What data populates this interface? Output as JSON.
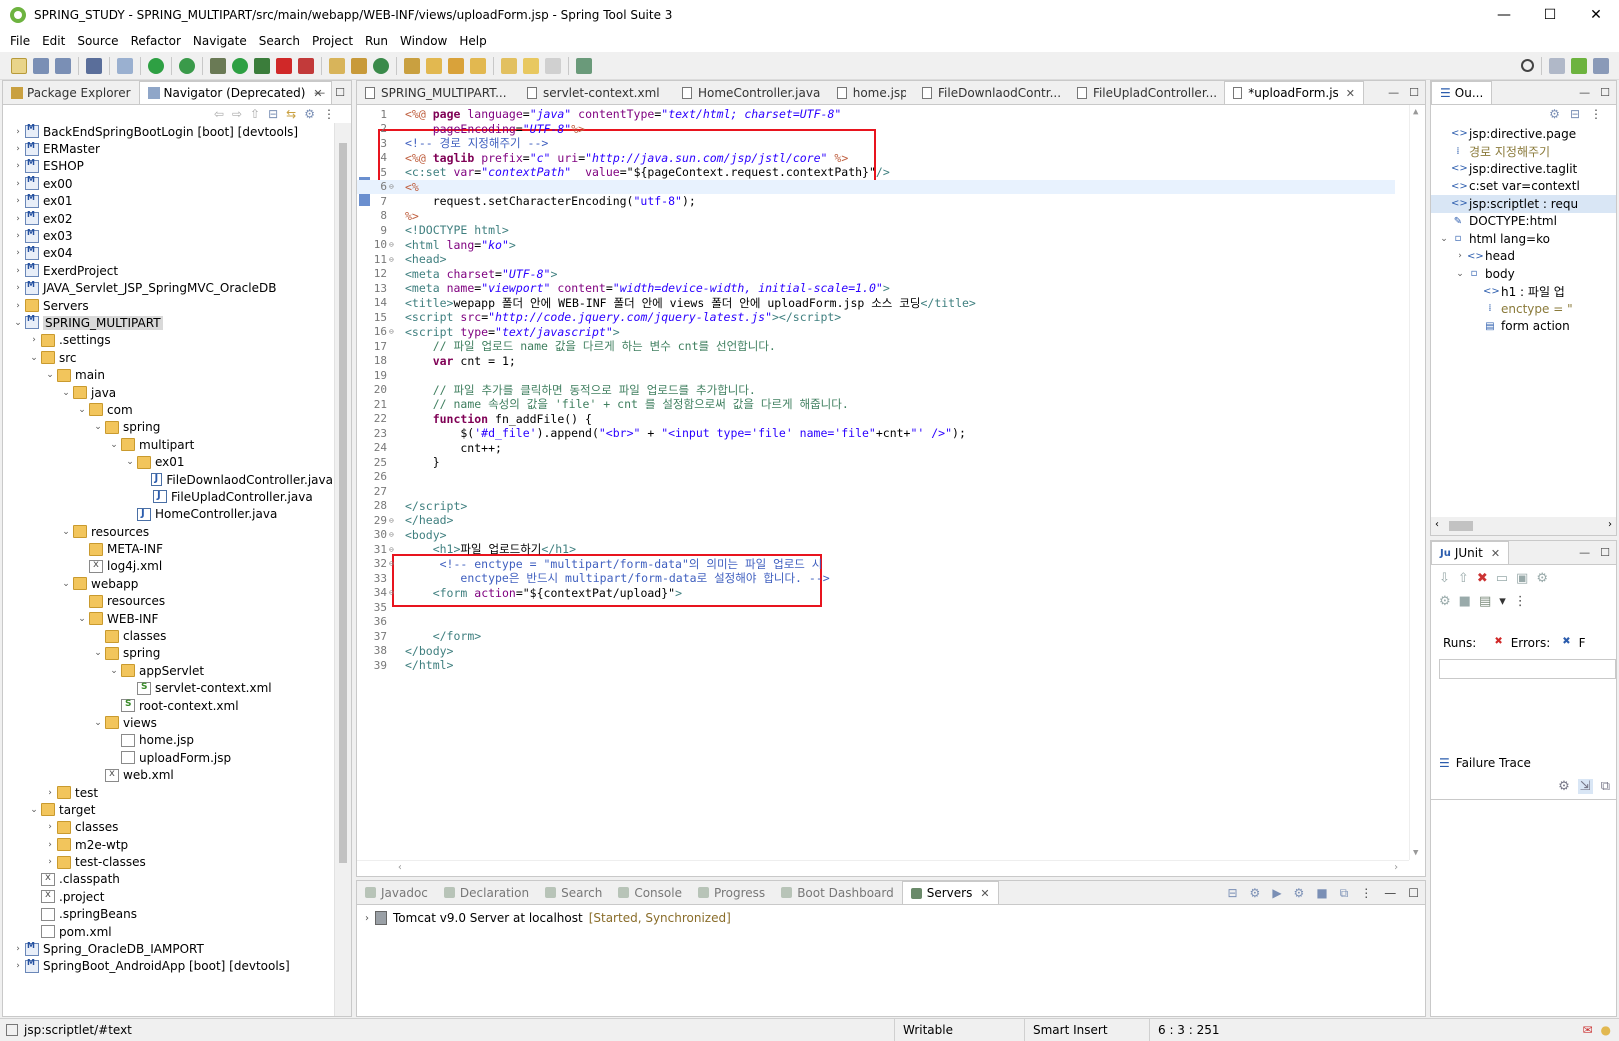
{
  "window": {
    "title": "SPRING_STUDY - SPRING_MULTIPART/src/main/webapp/WEB-INF/views/uploadForm.jsp - Spring Tool Suite 3",
    "minimize": "—",
    "maximize": "☐",
    "close": "✕"
  },
  "menu": [
    "File",
    "Edit",
    "Source",
    "Refactor",
    "Navigate",
    "Search",
    "Project",
    "Run",
    "Window",
    "Help"
  ],
  "left_panel": {
    "tabs": [
      {
        "label": "Package Explorer"
      },
      {
        "label": "Navigator (Deprecated)"
      }
    ],
    "tree": [
      {
        "label": "BackEndSpringBootLogin [boot] [devtools]",
        "depth": 0,
        "icon": "project",
        "twisty": "›"
      },
      {
        "label": "ERMaster",
        "depth": 0,
        "icon": "project",
        "twisty": "›"
      },
      {
        "label": "ESHOP",
        "depth": 0,
        "icon": "project",
        "twisty": "›"
      },
      {
        "label": "ex00",
        "depth": 0,
        "icon": "project",
        "twisty": "›"
      },
      {
        "label": "ex01",
        "depth": 0,
        "icon": "project",
        "twisty": "›"
      },
      {
        "label": "ex02",
        "depth": 0,
        "icon": "project",
        "twisty": "›"
      },
      {
        "label": "ex03",
        "depth": 0,
        "icon": "project",
        "twisty": "›"
      },
      {
        "label": "ex04",
        "depth": 0,
        "icon": "project",
        "twisty": "›"
      },
      {
        "label": "ExerdProject",
        "depth": 0,
        "icon": "project",
        "twisty": "›"
      },
      {
        "label": "JAVA_Servlet_JSP_SpringMVC_OracleDB",
        "depth": 0,
        "icon": "project",
        "twisty": "›"
      },
      {
        "label": "Servers",
        "depth": 0,
        "icon": "folder",
        "twisty": "›"
      },
      {
        "label": "SPRING_MULTIPART",
        "depth": 0,
        "icon": "project",
        "twisty": "⌄",
        "selected": true
      },
      {
        "label": ".settings",
        "depth": 1,
        "icon": "folder",
        "twisty": "›"
      },
      {
        "label": "src",
        "depth": 1,
        "icon": "folder",
        "twisty": "⌄"
      },
      {
        "label": "main",
        "depth": 2,
        "icon": "folder",
        "twisty": "⌄"
      },
      {
        "label": "java",
        "depth": 3,
        "icon": "folder",
        "twisty": "⌄"
      },
      {
        "label": "com",
        "depth": 4,
        "icon": "folder",
        "twisty": "⌄"
      },
      {
        "label": "spring",
        "depth": 5,
        "icon": "folder",
        "twisty": "⌄"
      },
      {
        "label": "multipart",
        "depth": 6,
        "icon": "folder",
        "twisty": "⌄"
      },
      {
        "label": "ex01",
        "depth": 7,
        "icon": "folder",
        "twisty": "⌄"
      },
      {
        "label": "FileDownlaodController.java",
        "depth": 8,
        "icon": "java",
        "twisty": ""
      },
      {
        "label": "FileUpladController.java",
        "depth": 8,
        "icon": "java",
        "twisty": ""
      },
      {
        "label": "HomeController.java",
        "depth": 7,
        "icon": "java",
        "twisty": ""
      },
      {
        "label": "resources",
        "depth": 3,
        "icon": "folder",
        "twisty": "⌄"
      },
      {
        "label": "META-INF",
        "depth": 4,
        "icon": "folder",
        "twisty": ""
      },
      {
        "label": "log4j.xml",
        "depth": 4,
        "icon": "xml",
        "twisty": ""
      },
      {
        "label": "webapp",
        "depth": 3,
        "icon": "folder",
        "twisty": "⌄"
      },
      {
        "label": "resources",
        "depth": 4,
        "icon": "folder",
        "twisty": ""
      },
      {
        "label": "WEB-INF",
        "depth": 4,
        "icon": "folder",
        "twisty": "⌄"
      },
      {
        "label": "classes",
        "depth": 5,
        "icon": "folder",
        "twisty": ""
      },
      {
        "label": "spring",
        "depth": 5,
        "icon": "folder",
        "twisty": "⌄"
      },
      {
        "label": "appServlet",
        "depth": 6,
        "icon": "folder",
        "twisty": "⌄"
      },
      {
        "label": "servlet-context.xml",
        "depth": 7,
        "icon": "spring",
        "twisty": ""
      },
      {
        "label": "root-context.xml",
        "depth": 6,
        "icon": "spring",
        "twisty": ""
      },
      {
        "label": "views",
        "depth": 5,
        "icon": "folder",
        "twisty": "⌄"
      },
      {
        "label": "home.jsp",
        "depth": 6,
        "icon": "file",
        "twisty": ""
      },
      {
        "label": "uploadForm.jsp",
        "depth": 6,
        "icon": "file",
        "twisty": ""
      },
      {
        "label": "web.xml",
        "depth": 5,
        "icon": "xml",
        "twisty": ""
      },
      {
        "label": "test",
        "depth": 2,
        "icon": "folder",
        "twisty": "›"
      },
      {
        "label": "target",
        "depth": 1,
        "icon": "folder",
        "twisty": "⌄"
      },
      {
        "label": "classes",
        "depth": 2,
        "icon": "folder",
        "twisty": "›"
      },
      {
        "label": "m2e-wtp",
        "depth": 2,
        "icon": "folder",
        "twisty": "›"
      },
      {
        "label": "test-classes",
        "depth": 2,
        "icon": "folder",
        "twisty": "›"
      },
      {
        "label": ".classpath",
        "depth": 1,
        "icon": "xml",
        "twisty": ""
      },
      {
        "label": ".project",
        "depth": 1,
        "icon": "xml",
        "twisty": ""
      },
      {
        "label": ".springBeans",
        "depth": 1,
        "icon": "file",
        "twisty": ""
      },
      {
        "label": "pom.xml",
        "depth": 1,
        "icon": "file",
        "twisty": ""
      },
      {
        "label": "Spring_OracleDB_IAMPORT",
        "depth": 0,
        "icon": "project",
        "twisty": "›"
      },
      {
        "label": "SpringBoot_AndroidApp [boot] [devtools]",
        "depth": 0,
        "icon": "project",
        "twisty": "›"
      }
    ]
  },
  "editor": {
    "tabs": [
      {
        "label": "SPRING_MULTIPART...",
        "active": false
      },
      {
        "label": "servlet-context.xml",
        "active": false
      },
      {
        "label": "HomeController.java",
        "active": false
      },
      {
        "label": "home.jsp",
        "active": false
      },
      {
        "label": "FileDownlaodContr...",
        "active": false
      },
      {
        "label": "FileUpladController...",
        "active": false
      },
      {
        "label": "*uploadForm.jsp",
        "active": true
      }
    ],
    "lines": [
      {
        "n": "1",
        "fold": "",
        "html": "<span class='jsp'>&lt;%@</span> <span class='kw'>page</span> <span class='attr'>language</span>=<span class='str'>\"java\"</span> <span class='attr'>contentType</span>=<span class='str'>\"text/html; charset=UTF-8\"</span>"
      },
      {
        "n": "2",
        "fold": "",
        "html": "    <span class='attr'>pageEncoding</span>=<span class='str'>\"UTF-8\"</span><span class='jsp'>%&gt;</span>"
      },
      {
        "n": "3",
        "fold": "",
        "html": "<span class='cmt'>&lt;!-- 경로 지정해주기 --&gt;</span>"
      },
      {
        "n": "4",
        "fold": "",
        "html": "<span class='jsp'>&lt;%@</span> <span class='kw'>taglib</span> <span class='attr'>prefix</span>=<span class='str'>\"c\"</span> <span class='attr'>uri</span>=<span class='str'>\"http://java.sun.com/jsp/jstl/core\"</span> <span class='jsp'>%&gt;</span>"
      },
      {
        "n": "5",
        "fold": "",
        "html": "<span class='tag'>&lt;c:set</span> <span class='attr'>var</span>=<span class='str'>\"contextPath\"</span>  <span class='attr'>value</span>=<span class='plain'>\"${pageContext.request.contextPath}\"</span><span class='tag'>/&gt;</span>"
      },
      {
        "n": "6",
        "fold": "⊖",
        "html": "<span class='jsp'>&lt;%</span>",
        "current": true
      },
      {
        "n": "7",
        "fold": "",
        "html": "    request.setCharacterEncoding(<span class='str' style='font-style:normal'>\"utf-8\"</span>);"
      },
      {
        "n": "8",
        "fold": "",
        "html": "<span class='jsp'>%&gt;</span>"
      },
      {
        "n": "9",
        "fold": "",
        "html": "<span class='tag'>&lt;!DOCTYPE html&gt;</span>"
      },
      {
        "n": "10",
        "fold": "⊖",
        "html": "<span class='tag'>&lt;html</span> <span class='attr'>lang</span>=<span class='str'>\"ko\"</span><span class='tag'>&gt;</span>"
      },
      {
        "n": "11",
        "fold": "⊖",
        "html": "<span class='tag'>&lt;head&gt;</span>"
      },
      {
        "n": "12",
        "fold": "",
        "html": "<span class='tag'>&lt;meta</span> <span class='attr'>charset</span>=<span class='str'>\"UTF-8\"</span><span class='tag'>&gt;</span>"
      },
      {
        "n": "13",
        "fold": "",
        "html": "<span class='tag'>&lt;meta</span> <span class='attr'>name</span>=<span class='str'>\"viewport\"</span> <span class='attr'>content</span>=<span class='str'>\"width=device-width, initial-scale=1.0\"</span><span class='tag'>&gt;</span>"
      },
      {
        "n": "14",
        "fold": "",
        "html": "<span class='tag'>&lt;title&gt;</span>wepapp 폴더 안에 WEB-INF 폴더 안에 views 폴더 안에 uploadForm.jsp 소스 코딩<span class='tag'>&lt;/title&gt;</span>"
      },
      {
        "n": "15",
        "fold": "",
        "html": "<span class='tag'>&lt;script</span> <span class='attr'>src</span>=<span class='str'>\"http://code.jquery.com/jquery-latest.js\"</span><span class='tag'>&gt;&lt;/script&gt;</span>"
      },
      {
        "n": "16",
        "fold": "⊖",
        "html": "<span class='tag'>&lt;script</span> <span class='attr'>type</span>=<span class='str'>\"text/javascript\"</span><span class='tag'>&gt;</span>"
      },
      {
        "n": "17",
        "fold": "",
        "html": "    <span class='cmt' style='color:#3f7f5f'>// 파일 업로드 name 값을 다르게 하는 변수 cnt를 선언합니다.</span>"
      },
      {
        "n": "18",
        "fold": "",
        "html": "    <span class='kw'>var</span> cnt = 1;"
      },
      {
        "n": "19",
        "fold": "",
        "html": ""
      },
      {
        "n": "20",
        "fold": "",
        "html": "    <span class='cmt' style='color:#3f7f5f'>// 파일 추가를 클릭하면 동적으로 파일 업로드를 추가합니다.</span>"
      },
      {
        "n": "21",
        "fold": "",
        "html": "    <span class='cmt' style='color:#3f7f5f'>// name 속성의 값을 'file' + cnt 를 설정함으로써 값을 다르게 해줍니다.</span>"
      },
      {
        "n": "22",
        "fold": "",
        "html": "    <span class='kw'>function</span> fn_addFile() {"
      },
      {
        "n": "23",
        "fold": "",
        "html": "        $(<span class='str' style='font-style:normal'>'#d_file'</span>).append(<span class='str' style='font-style:normal'>\"&lt;br&gt;\"</span> + <span class='str' style='font-style:normal'>\"&lt;input type='file' name='file\"</span>+cnt+<span class='str' style='font-style:normal'>\"' /&gt;\"</span>);"
      },
      {
        "n": "24",
        "fold": "",
        "html": "        cnt++;"
      },
      {
        "n": "25",
        "fold": "",
        "html": "    }"
      },
      {
        "n": "26",
        "fold": "",
        "html": ""
      },
      {
        "n": "27",
        "fold": "",
        "html": ""
      },
      {
        "n": "28",
        "fold": "",
        "html": "<span class='tag'>&lt;/script&gt;</span>"
      },
      {
        "n": "29",
        "fold": "⊖",
        "html": "<span class='tag'>&lt;/head&gt;</span>"
      },
      {
        "n": "30",
        "fold": "⊖",
        "html": "<span class='tag'>&lt;body&gt;</span>"
      },
      {
        "n": "31",
        "fold": "⊖",
        "html": "    <span class='tag'>&lt;h1&gt;</span>파일 업로드하기<span class='tag'>&lt;/h1&gt;</span>"
      },
      {
        "n": "32",
        "fold": "⊖",
        "html": "     <span class='cmt'>&lt;!-- enctype = \"multipart/form-data\"의 의미는 파일 업로드 시</span>"
      },
      {
        "n": "33",
        "fold": "",
        "html": "        <span class='cmt'>enctype은 반드시 multipart/form-data로 설정해야 합니다. --&gt;</span>"
      },
      {
        "n": "34",
        "fold": "⊖",
        "html": "    <span class='tag'>&lt;form</span> <span class='attr'>action</span>=<span class='plain'>\"${contextPat/upload}\"</span><span class='tag'>&gt;</span>"
      },
      {
        "n": "35",
        "fold": "",
        "html": ""
      },
      {
        "n": "36",
        "fold": "",
        "html": ""
      },
      {
        "n": "37",
        "fold": "",
        "html": "    <span class='tag'>&lt;/form&gt;</span>"
      },
      {
        "n": "38",
        "fold": "",
        "html": "<span class='tag'>&lt;/body&gt;</span>"
      },
      {
        "n": "39",
        "fold": "",
        "html": "<span class='tag'>&lt;/html&gt;</span>"
      }
    ]
  },
  "outline": {
    "tab_label": "Ou...",
    "items": [
      {
        "label": "jsp:directive.page",
        "depth": 0,
        "icon": "<>",
        "twisty": ""
      },
      {
        "label": "경로 지정해주기",
        "depth": 0,
        "icon": "⁞",
        "twisty": ""
      },
      {
        "label": "jsp:directive.taglit",
        "depth": 0,
        "icon": "<>",
        "twisty": ""
      },
      {
        "label": "c:set var=contextl",
        "depth": 0,
        "icon": "<>",
        "twisty": ""
      },
      {
        "label": "jsp:scriptlet : requ",
        "depth": 0,
        "icon": "<>",
        "twisty": "",
        "selected": true
      },
      {
        "label": "DOCTYPE:html",
        "depth": 0,
        "icon": "✎",
        "twisty": ""
      },
      {
        "label": "html lang=ko",
        "depth": 0,
        "icon": "▫",
        "twisty": "⌄"
      },
      {
        "label": "head",
        "depth": 1,
        "icon": "<>",
        "twisty": "›"
      },
      {
        "label": "body",
        "depth": 1,
        "icon": "▫",
        "twisty": "⌄"
      },
      {
        "label": "h1 : 파일 업",
        "depth": 2,
        "icon": "<>",
        "twisty": ""
      },
      {
        "label": "enctype = \"",
        "depth": 2,
        "icon": "⁞",
        "twisty": ""
      },
      {
        "label": "form action",
        "depth": 2,
        "icon": "▤",
        "twisty": ""
      }
    ]
  },
  "junit": {
    "tab_label": "JUnit",
    "runs_label": "Runs:",
    "errors_label": "Errors:",
    "failures_label": "F",
    "failure_trace_label": "Failure Trace"
  },
  "bottom_panel": {
    "tabs": [
      {
        "label": "Javadoc",
        "active": false
      },
      {
        "label": "Declaration",
        "active": false
      },
      {
        "label": "Search",
        "active": false
      },
      {
        "label": "Console",
        "active": false
      },
      {
        "label": "Progress",
        "active": false
      },
      {
        "label": "Boot Dashboard",
        "active": false
      },
      {
        "label": "Servers",
        "active": true
      }
    ],
    "server_name": "Tomcat v9.0 Server at localhost",
    "server_status": "[Started, Synchronized]"
  },
  "status_bar": {
    "left": "jsp:scriptlet/#text",
    "writable": "Writable",
    "insert_mode": "Smart Insert",
    "position": "6 : 3 : 251"
  },
  "colors": {
    "highlight_box": "#e8141e",
    "selection": "#d9e6f5",
    "current_line": "#e8f2fe"
  }
}
